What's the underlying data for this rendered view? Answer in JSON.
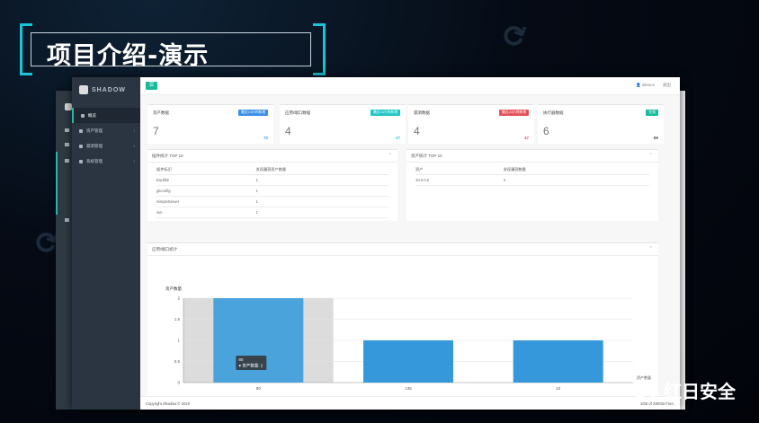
{
  "slide": {
    "title": "项目介绍-演示",
    "brand": "红日安全"
  },
  "app": {
    "logo_text": "SHADOW",
    "topbar": {
      "user": "silence",
      "logout": "退出"
    },
    "sidebar": {
      "items": [
        {
          "label": "概览",
          "active": true
        },
        {
          "label": "资产管理",
          "active": false
        },
        {
          "label": "漏洞管理",
          "active": false
        },
        {
          "label": "系统管理",
          "active": false
        }
      ]
    },
    "cards": [
      {
        "label": "资产数据",
        "badge": "最近24小时新增",
        "badge_color": "#3a8ee6",
        "value": "7",
        "delta": "72",
        "delta_color": "#3a8ee6"
      },
      {
        "label": "应用/端口数据",
        "badge": "最近24小时新增",
        "badge_color": "#1fc6c6",
        "value": "4",
        "delta": "47",
        "delta_color": "#1fc6c6"
      },
      {
        "label": "漏洞数据",
        "badge": "最近24小时新增",
        "badge_color": "#e6505a",
        "value": "4",
        "delta": "47",
        "delta_color": "#e6505a"
      },
      {
        "label": "执行器数据",
        "badge": "在线",
        "badge_color": "#1abb9c",
        "value": "6",
        "delta": "0♥",
        "delta_color": "#333"
      }
    ],
    "plugin_panel": {
      "title": "插件统计 TOP 10",
      "headers": [
        "插件标识",
        "发现漏洞资产数量"
      ],
      "rows": [
        [
          "backfile",
          "1"
        ],
        [
          "gitconfig",
          "1"
        ],
        [
          "SimpleServer",
          "1"
        ],
        [
          "svn",
          "1"
        ]
      ]
    },
    "asset_panel": {
      "title": "资产统计 TOP 10",
      "headers": [
        "资产",
        "发现漏洞数量"
      ],
      "rows": [
        [
          "10.0.0.2",
          "4"
        ]
      ]
    },
    "chart_panel": {
      "title": "应用/端口统计"
    },
    "tooltip": {
      "title": "80",
      "line": "资产数量: 2"
    },
    "footer": {
      "left": "Copyright Shadow © 2019",
      "right": "1GB of 290GB Free."
    }
  },
  "chart_data": {
    "type": "bar",
    "ylabel": "资产数量",
    "categories": [
      "80",
      "135",
      "22"
    ],
    "values": [
      2,
      1,
      1
    ],
    "ylim": [
      0,
      2
    ],
    "yticks": [
      "0",
      "0.5",
      "1",
      "1.5",
      "2"
    ],
    "legend_label": "资产数量",
    "bar_color": "#3498db",
    "highlight_index": 0
  }
}
